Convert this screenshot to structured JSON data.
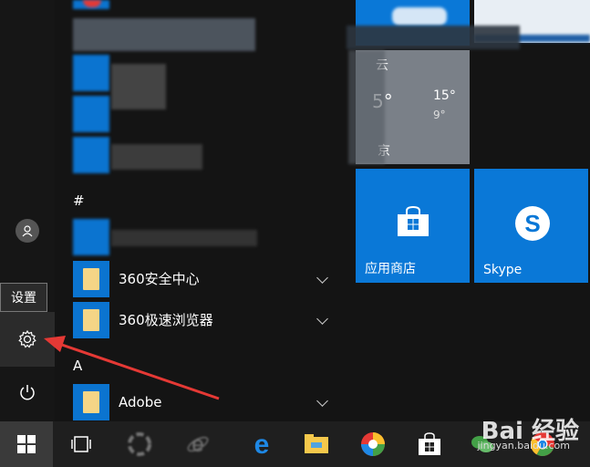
{
  "rail": {
    "tooltip": "设置"
  },
  "applist": {
    "sections": [
      "#",
      "A"
    ],
    "apps": [
      {
        "label": "360安全中心",
        "icon": "folder-icon"
      },
      {
        "label": "360极速浏览器",
        "icon": "folder-icon"
      },
      {
        "label": "Adobe",
        "icon": "folder-icon"
      }
    ]
  },
  "tiles": {
    "weather": {
      "line1": "云",
      "temp_left": "5°",
      "high": "15°",
      "low": "9°",
      "city": "京"
    },
    "store": {
      "label": "应用商店",
      "icon": "store-icon"
    },
    "skype": {
      "label": "Skype",
      "icon": "skype-icon"
    }
  },
  "taskbar": {
    "icons": [
      "start-icon",
      "task-view-icon",
      "pinwheel-icon",
      "ie-icon",
      "edge-icon",
      "file-explorer-icon",
      "photos-icon",
      "store-icon",
      "wechat-icon",
      "chrome-icon"
    ]
  },
  "watermark": {
    "brand": "Bai 经验",
    "url": "jingyan.baidu.com"
  },
  "colors": {
    "tile_blue": "#0a78d7",
    "accent_red": "#e53935"
  }
}
